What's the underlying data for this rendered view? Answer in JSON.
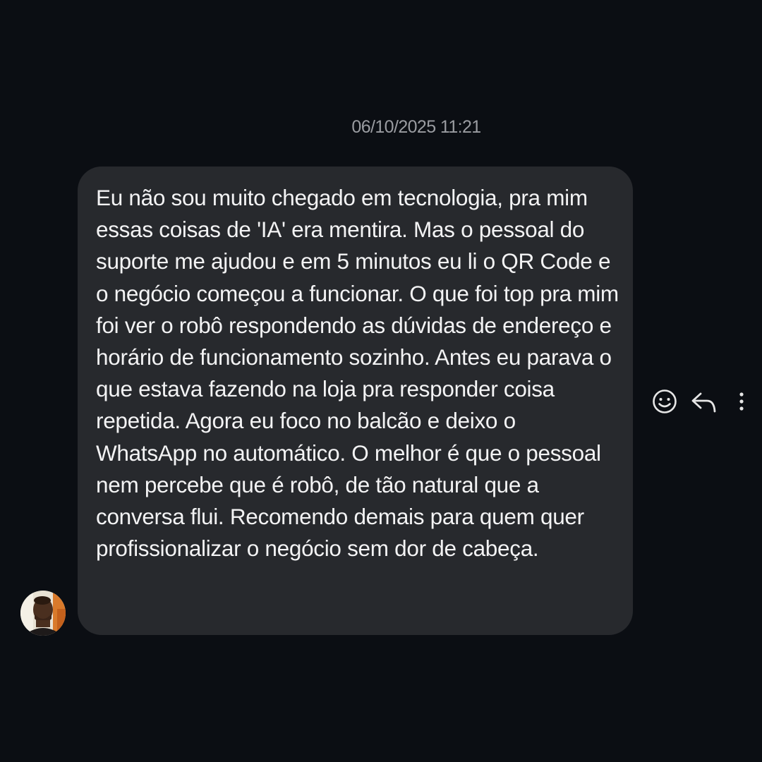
{
  "timestamp": "06/10/2025 11:21",
  "message": {
    "text": "Eu não sou muito chegado em tecnologia, pra mim essas coisas de 'IA' era mentira. Mas o pessoal do suporte me ajudou e em 5 minutos eu li o QR Code e o negócio começou a funcionar. O que foi top pra mim foi ver o robô respondendo as dúvidas de endereço e horário de funcionamento sozinho. Antes eu parava o que estava fazendo na loja pra responder coisa repetida. Agora eu foco no balcão e deixo o WhatsApp no automático. O melhor é que o pessoal nem percebe que é robô, de tão natural que a conversa flui. Recomendo demais para quem quer profissionalizar o negócio sem dor de cabeça."
  },
  "actions": [
    {
      "icon": "smiley-icon"
    },
    {
      "icon": "reply-icon"
    },
    {
      "icon": "more-vertical-icon"
    }
  ],
  "colors": {
    "background": "#0b0e13",
    "bubble": "#27292d",
    "message_text": "#f3f3f4",
    "timestamp_text": "#9a9ca1",
    "icon": "#e6e6e6"
  }
}
